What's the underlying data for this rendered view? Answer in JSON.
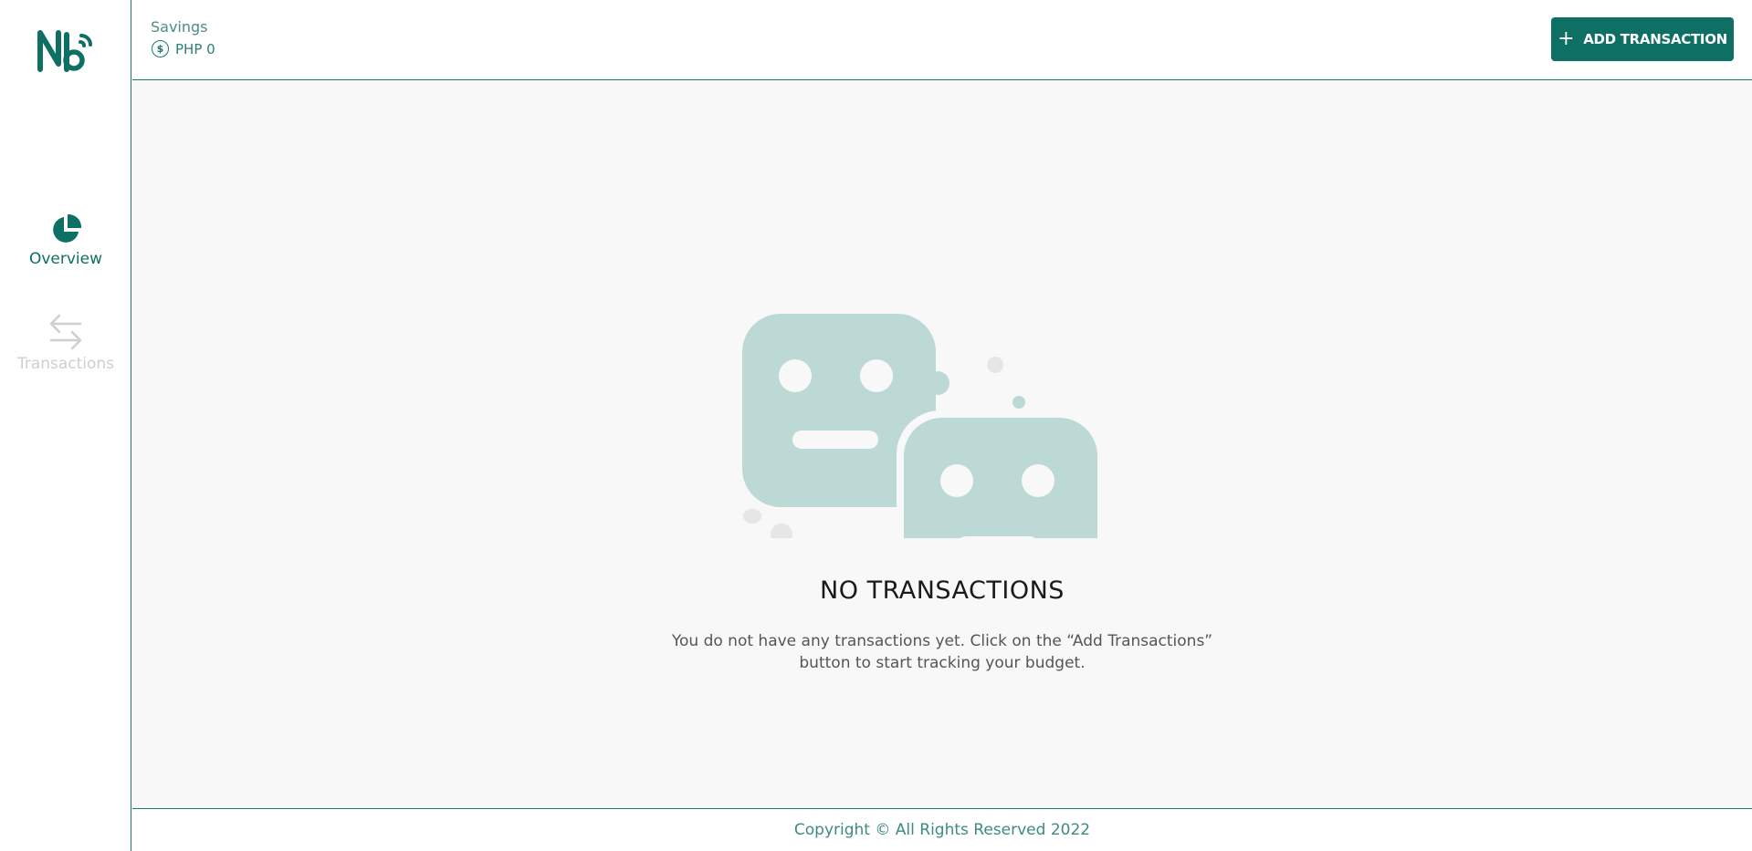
{
  "app": {
    "brand_colors": {
      "primary": "#0e6f64",
      "accent": "#1b7a6f",
      "illustration": "#bcd9d6"
    }
  },
  "sidebar": {
    "logo_icon": "nb-logo",
    "items": [
      {
        "label": "Overview",
        "icon": "pie-chart-icon",
        "active": true
      },
      {
        "label": "Transactions",
        "icon": "swap-arrows-icon",
        "active": false
      }
    ]
  },
  "header": {
    "savings_label": "Savings",
    "savings_value": "PHP 0",
    "savings_icon": "dollar-circle-icon",
    "add_button_label": "ADD TRANSACTION",
    "add_button_icon": "plus-icon"
  },
  "empty_state": {
    "title": "NO TRANSACTIONS",
    "description": "You do not have any transactions yet. Click on the “Add Transactions” button to start tracking your budget.",
    "illustration": "two-robot-faces"
  },
  "footer": {
    "copyright": "Copyright © All Rights Reserved 2022"
  }
}
